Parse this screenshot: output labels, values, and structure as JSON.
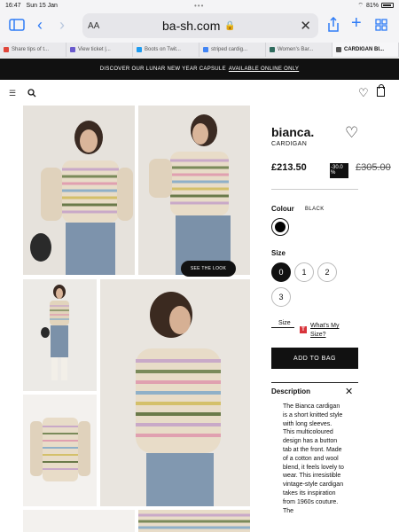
{
  "status": {
    "time": "16:47",
    "date": "Sun 15 Jan",
    "battery": "81%"
  },
  "browser": {
    "aa_label": "AA",
    "domain": "ba-sh.com",
    "tabs": [
      {
        "label": "Share tips of t...",
        "color": "#e0463a"
      },
      {
        "label": "View ticket |...",
        "color": "#6a5acd"
      },
      {
        "label": "Boots on Twit...",
        "color": "#1d9bf0"
      },
      {
        "label": "striped cardig...",
        "color": "#4285f4"
      },
      {
        "label": "Women's Bar...",
        "color": "#2e6b5e"
      },
      {
        "label": "CARDIGAN BI...",
        "color": "#555555"
      }
    ]
  },
  "promo": {
    "text": "DISCOVER OUR LUNAR NEW YEAR CAPSULE",
    "link": "AVAILABLE ONLINE ONLY"
  },
  "gallery": {
    "see_look": "SEE THE LOOK"
  },
  "product": {
    "name": "bianca.",
    "category": "CARDIGAN",
    "price": "£213.50",
    "discount": "-30.0 %",
    "old_price": "£305.00",
    "colour_label": "Colour",
    "colour_value": "BLACK",
    "size_label": "Size",
    "sizes": [
      "0",
      "1",
      "2",
      "3"
    ],
    "selected_size": "0",
    "size_guide": "Size",
    "whats_my_size": "What's My Size?",
    "add_to_bag": "ADD TO BAG",
    "description_title": "Description",
    "description": "The Bianca cardigan is a short knitted style with long sleeves. This multicoloured design has a button tab at the front. Made of a cotton and wool blend, it feels lovely to wear. This irresistible vintage-style cardigan takes its inspiration from 1960s couture. The"
  },
  "icons": {
    "sidebar": "sidebar-icon",
    "back": "chevron-left-icon",
    "forward": "chevron-right-icon",
    "share": "share-icon",
    "new_tab": "plus-icon",
    "tabs": "tab-grid-icon",
    "menu": "hamburger-icon",
    "search": "search-icon",
    "wishlist": "heart-icon",
    "bag": "bag-icon"
  }
}
